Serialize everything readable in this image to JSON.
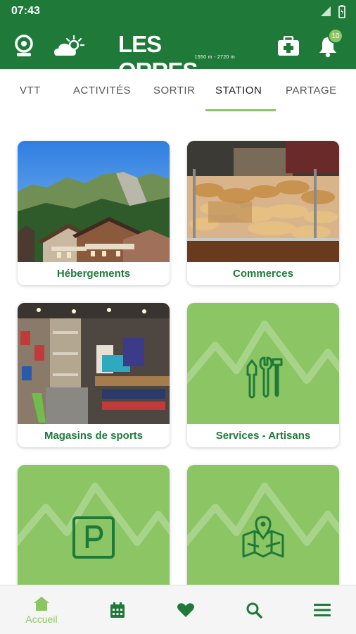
{
  "status_bar": {
    "time": "07:43"
  },
  "header": {
    "logo_text": "LES ORRES",
    "logo_subtitle": "1550 m - 2720 m",
    "notification_count": "10",
    "icons": [
      "webcam-icon",
      "weather-icon",
      "first-aid-kit-icon",
      "notification-bell-icon"
    ]
  },
  "tabs": [
    {
      "label": "VTT",
      "active": false
    },
    {
      "label": "ACTIVITÉS",
      "active": false
    },
    {
      "label": "SORTIR",
      "active": false
    },
    {
      "label": "STATION",
      "active": true
    },
    {
      "label": "PARTAGE",
      "active": false
    }
  ],
  "cards": [
    {
      "label": "Hébergements",
      "image": "mountain-chalets-photo"
    },
    {
      "label": "Commerces",
      "image": "bakery-photo"
    },
    {
      "label": "Magasins de sports",
      "image": "sports-shop-photo"
    },
    {
      "label": "Services - Artisans",
      "image": "tools-icon"
    },
    {
      "label": "",
      "image": "parking-icon"
    },
    {
      "label": "",
      "image": "map-icon"
    }
  ],
  "bottom_nav": [
    {
      "label": "Accueil",
      "icon": "home-icon",
      "active": true
    },
    {
      "label": "",
      "icon": "calendar-icon"
    },
    {
      "label": "",
      "icon": "heart-icon"
    },
    {
      "label": "",
      "icon": "search-icon"
    },
    {
      "label": "",
      "icon": "menu-icon"
    }
  ],
  "colors": {
    "primary": "#1f7a3a",
    "accent": "#8cc563"
  }
}
